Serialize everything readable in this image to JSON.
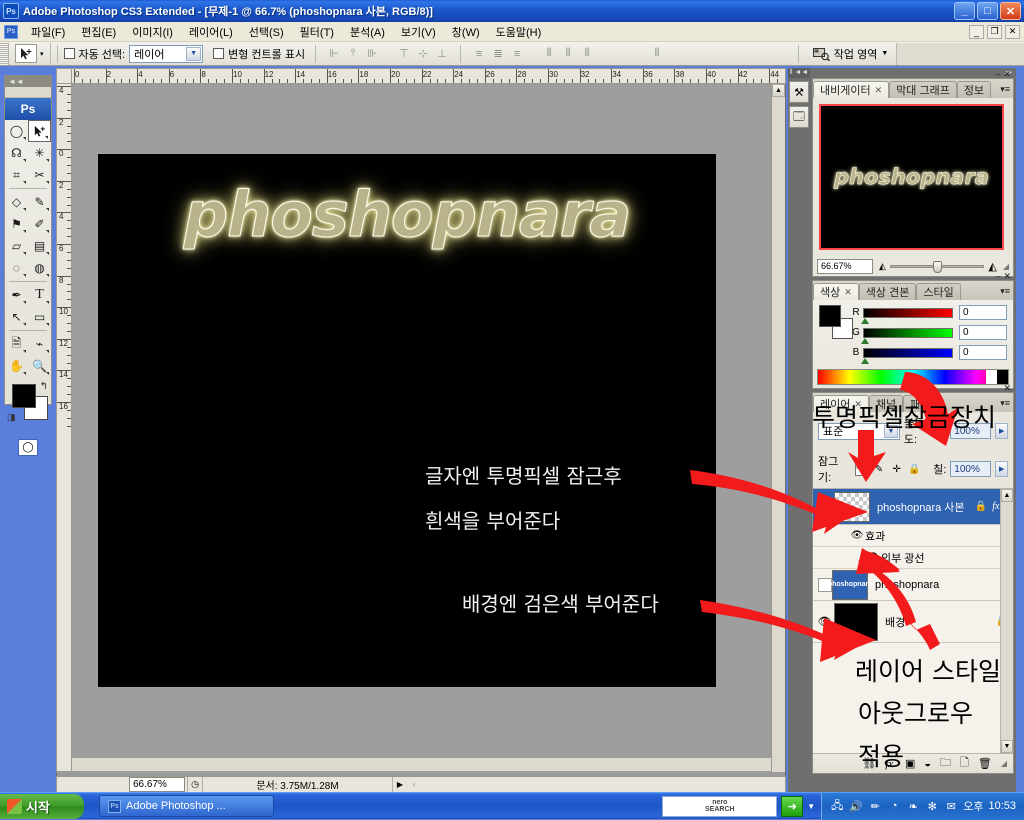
{
  "window": {
    "title": "Adobe Photoshop CS3 Extended - [무제-1 @ 66.7% (phoshopnara 사본, RGB/8)]",
    "app_icon": "photoshop-icon",
    "minimize": "_",
    "maximize": "□",
    "close": "✕"
  },
  "doc_window": {
    "minimize": "_",
    "restore": "❐",
    "close": "✕"
  },
  "menu": {
    "items": [
      {
        "label": "파일(F)"
      },
      {
        "label": "편집(E)"
      },
      {
        "label": "이미지(I)"
      },
      {
        "label": "레이어(L)"
      },
      {
        "label": "선택(S)"
      },
      {
        "label": "필터(T)"
      },
      {
        "label": "분석(A)"
      },
      {
        "label": "보기(V)"
      },
      {
        "label": "창(W)"
      },
      {
        "label": "도움말(H)"
      }
    ]
  },
  "options_bar": {
    "tool_icon": "move-tool-icon",
    "auto_select_label": "자동 선택:",
    "auto_select_value": "레이어",
    "show_transform_label": "변형 컨트롤 표시",
    "align_icons": [
      "align-left-edges",
      "align-horizontal-centers",
      "align-right-edges",
      "align-top-edges",
      "align-vertical-centers",
      "align-bottom-edges"
    ],
    "distribute_icons": [
      "distribute-top",
      "distribute-vertical-center",
      "distribute-bottom",
      "distribute-left",
      "distribute-horizontal-center",
      "distribute-right"
    ],
    "extra_icon": "auto-align-layers-icon",
    "workspace_label": "작업 영역",
    "workspace_icon": "workspace-icon"
  },
  "toolbox": {
    "logo": "Ps",
    "tools": [
      {
        "name": "marquee-tool",
        "glyph": "◯"
      },
      {
        "name": "move-tool",
        "glyph": "➤",
        "active": true
      },
      {
        "name": "lasso-tool",
        "glyph": "♺"
      },
      {
        "name": "magic-wand-tool",
        "glyph": "✳"
      },
      {
        "name": "crop-tool",
        "glyph": "⌗"
      },
      {
        "name": "slice-tool",
        "glyph": "✂"
      },
      {
        "name": "healing-brush-tool",
        "glyph": "◇"
      },
      {
        "name": "brush-tool",
        "glyph": "✎"
      },
      {
        "name": "clone-stamp-tool",
        "glyph": "⚑"
      },
      {
        "name": "history-brush-tool",
        "glyph": "✐"
      },
      {
        "name": "eraser-tool",
        "glyph": "▱"
      },
      {
        "name": "gradient-tool",
        "glyph": "▤"
      },
      {
        "name": "blur-tool",
        "glyph": "◌"
      },
      {
        "name": "dodge-tool",
        "glyph": "◍"
      },
      {
        "name": "pen-tool",
        "glyph": "✒"
      },
      {
        "name": "type-tool",
        "glyph": "T"
      },
      {
        "name": "path-selection-tool",
        "glyph": "↖"
      },
      {
        "name": "shape-tool",
        "glyph": "▭"
      },
      {
        "name": "notes-tool",
        "glyph": "🗉"
      },
      {
        "name": "eyedropper-tool",
        "glyph": "⌁"
      },
      {
        "name": "hand-tool",
        "glyph": "✋"
      },
      {
        "name": "zoom-tool",
        "glyph": "🔍"
      }
    ],
    "foreground_color": "#000000",
    "background_color": "#ffffff",
    "swap_icon": "swap-colors-icon",
    "default_icon": "default-colors-icon",
    "quickmask_standard": "standard-mode-icon",
    "quickmask_mask": "quickmask-mode-icon"
  },
  "rulers": {
    "h_ticks": [
      "0",
      "2",
      "4",
      "6",
      "8",
      "10",
      "12",
      "14",
      "16",
      "18",
      "20",
      "22",
      "24",
      "26",
      "28",
      "30",
      "32",
      "34",
      "36",
      "38",
      "40",
      "42",
      "44"
    ],
    "v_ticks": [
      "4",
      "2",
      "0",
      "2",
      "4",
      "6",
      "8",
      "10",
      "12",
      "14",
      "16"
    ]
  },
  "canvas": {
    "artwork_text": "phoshopnara",
    "glow_color": "#f6f0b0",
    "text_color": "#b9b38c",
    "background_color": "#000000",
    "notes": [
      {
        "id": "note-line-1",
        "text": "글자엔 투명픽셀 잠근후"
      },
      {
        "id": "note-line-2",
        "text": "흰색을 부어준다"
      },
      {
        "id": "note-line-3",
        "text": "배경엔 검은색 부어준다"
      }
    ]
  },
  "overlay_notes": [
    {
      "id": "overlay-lock-label",
      "text": "투명픽셀잠금장치"
    },
    {
      "id": "overlay-style-line1",
      "text": "레이어 스타일"
    },
    {
      "id": "overlay-style-line2",
      "text": "아웃그로우"
    },
    {
      "id": "overlay-style-line3",
      "text": "적용"
    }
  ],
  "doc_status": {
    "zoom": "66.67%",
    "clock_icon": "clock-icon",
    "doc_info": "문서: 3.75M/1.28M",
    "more_icon": "▶"
  },
  "dock": {
    "collapse_icon": "collapse-panels-icon",
    "icons": [
      {
        "name": "tools-preset-icon",
        "glyph": "⚒"
      },
      {
        "name": "layer-comps-icon",
        "glyph": "🗔"
      }
    ]
  },
  "navigator_panel": {
    "tabs": [
      {
        "label": "내비게이터",
        "active": true,
        "closable": true
      },
      {
        "label": "막대 그래프",
        "active": false,
        "closable": false
      },
      {
        "label": "정보",
        "active": false,
        "closable": false
      }
    ],
    "menu_icon": "panel-menu-icon",
    "minimize_icon": "–",
    "close_icon": "✕",
    "thumbnail_text": "phoshopnara",
    "view_box_color": "#ff4646",
    "zoom_value": "66.67%",
    "zoom_out_icon": "zoom-out-icon",
    "zoom_in_icon": "zoom-in-icon"
  },
  "color_panel": {
    "tabs": [
      {
        "label": "색상",
        "active": true,
        "closable": true
      },
      {
        "label": "색상 견본",
        "active": false,
        "closable": false
      },
      {
        "label": "스타일",
        "active": false,
        "closable": false
      }
    ],
    "menu_icon": "panel-menu-icon",
    "minimize_icon": "–",
    "close_icon": "✕",
    "foreground_color": "#000000",
    "background_color": "#ffffff",
    "channels": [
      {
        "label": "R",
        "value": "0",
        "color": "#ff0000"
      },
      {
        "label": "G",
        "value": "0",
        "color": "#00ff00"
      },
      {
        "label": "B",
        "value": "0",
        "color": "#0000ff"
      }
    ]
  },
  "layers_panel": {
    "tabs": [
      {
        "label": "레이어",
        "active": true,
        "closable": true
      },
      {
        "label": "채널",
        "active": false,
        "closable": false
      },
      {
        "label": "패스",
        "active": false,
        "closable": false
      }
    ],
    "menu_icon": "panel-menu-icon",
    "close_icon": "✕",
    "blend_mode": "표준",
    "opacity_label": "불투명도:",
    "opacity_value": "100%",
    "lock_label": "잠그기:",
    "lock_icons": [
      {
        "name": "lock-transparent-pixels-icon",
        "glyph": "▦"
      },
      {
        "name": "lock-image-pixels-icon",
        "glyph": "✎"
      },
      {
        "name": "lock-position-icon",
        "glyph": "✛"
      },
      {
        "name": "lock-all-icon",
        "glyph": "🔒"
      }
    ],
    "fill_label": "칠:",
    "fill_value": "100%",
    "rows": [
      {
        "type": "layer",
        "name": "phoshopnara 사본",
        "selected": true,
        "visible": true,
        "thumb": "checker",
        "badges": [
          "lock-icon",
          "fx-icon",
          "expand-icon"
        ]
      },
      {
        "type": "effects-header",
        "name": "효과",
        "visible": true
      },
      {
        "type": "effect",
        "name": "외부 광선",
        "visible": true
      },
      {
        "type": "layer",
        "name": "phoshopnara",
        "selected": false,
        "visible": false,
        "thumb": "text",
        "thumb_text": "phoshopnara",
        "badges": []
      },
      {
        "type": "layer",
        "name": "배경",
        "selected": false,
        "visible": true,
        "thumb": "black",
        "badges": [
          "lock-icon"
        ]
      }
    ],
    "footer_icons": [
      {
        "name": "link-layers-icon",
        "glyph": "⛓"
      },
      {
        "name": "add-layer-style-icon",
        "glyph": "ƒx"
      },
      {
        "name": "add-layer-mask-icon",
        "glyph": "▣"
      },
      {
        "name": "new-adjustment-layer-icon",
        "glyph": "◒"
      },
      {
        "name": "new-group-icon",
        "glyph": "🗀"
      },
      {
        "name": "new-layer-icon",
        "glyph": "🗋"
      },
      {
        "name": "delete-layer-icon",
        "glyph": "🗑"
      }
    ]
  },
  "taskbar": {
    "start_label": "시작",
    "start_icon": "windows-flag-icon",
    "task_label": "Adobe Photoshop ...",
    "task_icon": "photoshop-icon",
    "nero_line1": "nero",
    "nero_line2": "SEARCH",
    "nero_go_icon": "go-arrow-icon",
    "tray_icons": [
      {
        "name": "network-error-icon",
        "glyph": "🖧"
      },
      {
        "name": "volume-icon",
        "glyph": "🔊"
      },
      {
        "name": "pen-icon",
        "glyph": "✏"
      },
      {
        "name": "shield-icon",
        "glyph": "◔"
      },
      {
        "name": "leaf-icon",
        "glyph": "🍃"
      },
      {
        "name": "settings-icon",
        "glyph": "✻"
      },
      {
        "name": "messenger-icon",
        "glyph": "✉"
      }
    ],
    "clock_ampm": "오후",
    "clock_time": "10:53"
  }
}
